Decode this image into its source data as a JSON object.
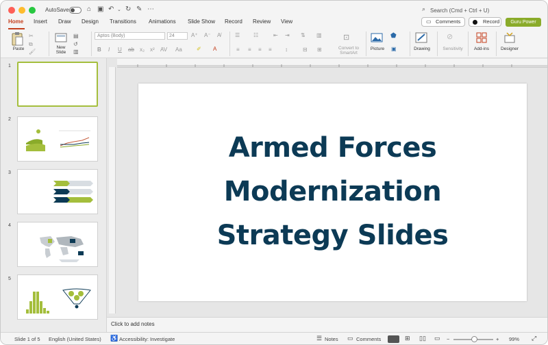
{
  "titlebar": {
    "autosave_label": "AutoSave",
    "search_placeholder": "Search (Cmd + Ctrl + U)"
  },
  "tabs": [
    {
      "label": "Home"
    },
    {
      "label": "Insert"
    },
    {
      "label": "Draw"
    },
    {
      "label": "Design"
    },
    {
      "label": "Transitions"
    },
    {
      "label": "Animations"
    },
    {
      "label": "Slide Show"
    },
    {
      "label": "Record"
    },
    {
      "label": "Review"
    },
    {
      "label": "View"
    }
  ],
  "header_buttons": {
    "comments": "Comments",
    "record": "Record",
    "guru": "Guru Power"
  },
  "ribbon": {
    "paste": "Paste",
    "new_slide": "New\nSlide",
    "font_name": "Aptos (Body)",
    "font_size": "24",
    "convert": "Convert to\nSmartArt",
    "picture": "Picture",
    "drawing": "Drawing",
    "sensitivity": "Sensitivity",
    "addins": "Add-ins",
    "designer": "Designer"
  },
  "slides": [
    {
      "num": "1"
    },
    {
      "num": "2"
    },
    {
      "num": "3"
    },
    {
      "num": "4"
    },
    {
      "num": "5"
    }
  ],
  "slide": {
    "title_lines": [
      "Armed Forces",
      "Modernization",
      "Strategy Slides"
    ]
  },
  "notes_placeholder": "Click to add notes",
  "status": {
    "slide_count": "Slide 1 of 5",
    "language": "English (United States)",
    "accessibility": "Accessibility: Investigate",
    "notes": "Notes",
    "comments": "Comments",
    "zoom": "99%"
  },
  "colors": {
    "accent_tab": "#c43e1c",
    "guru_button": "#8aab2a",
    "title_text": "#0c3a55",
    "selected_thumb": "#a4be3c"
  }
}
